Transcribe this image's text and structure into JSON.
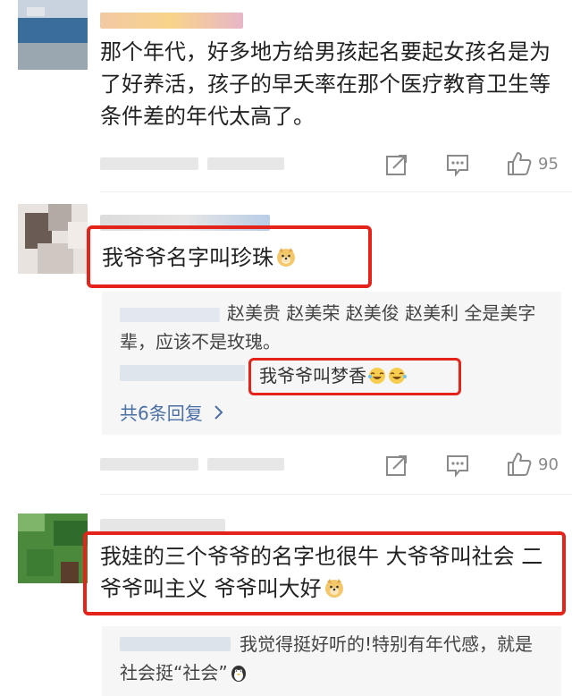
{
  "comments": [
    {
      "text": "那个年代，好多地方给男孩起名要起女孩名是为了好养活，孩子的早夭率在那个医疗教育卫生等条件差的年代太高了。",
      "likes": "95"
    },
    {
      "text": "我爷爷名字叫珍珠",
      "replies": [
        {
          "text": "赵美贵 赵美荣 赵美俊 赵美利 全是美字辈，应该不是玫瑰。"
        },
        {
          "text": "我爷爷叫梦香"
        }
      ],
      "more_replies": "共6条回复",
      "likes": "90"
    },
    {
      "text": "我娃的三个爷爷的名字也很牛 大爷爷叫社会 二爷爷叫主义 爷爷叫大好",
      "replies": [
        {
          "text": "我觉得挺好听的!特别有年代感，就是社会挺“社会”"
        }
      ]
    }
  ],
  "colors": {
    "highlight": "#e4231b",
    "link": "#4a6fa5",
    "reply_bg": "#f6f6f6"
  },
  "icons": [
    "share-icon",
    "comment-icon",
    "thumbs-up-icon",
    "chevron-right-icon",
    "doge-emoji",
    "laugh-cry-emoji",
    "penguin-emoji"
  ]
}
